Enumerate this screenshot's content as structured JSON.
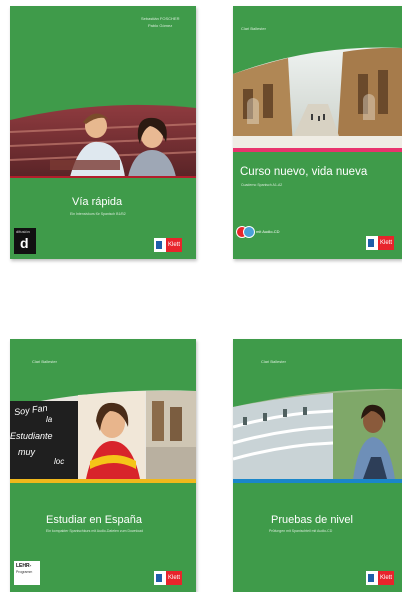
{
  "covers": [
    {
      "title": "Vía rápida",
      "author": "Sebastián FOSCHER",
      "author2": "Pablo Gómez",
      "subtitle": "Ein Intensivkurs für Spanisch B1/B2",
      "publisher_small": "difusión",
      "publisher_logo_glyph": "d",
      "klett_label": "Klett",
      "colors": {
        "bg": "#3f9b4a",
        "stripe": "#b21e2b"
      }
    },
    {
      "title": "Curso nuevo, vida nueva",
      "author": "Clari Ballester",
      "subtitle": "Cuaderno Spanisch A1-A2",
      "cd_label": "mit Audio-CD",
      "klett_label": "Klett",
      "colors": {
        "bg": "#3f9b4a",
        "stripe": "#e8336d"
      }
    },
    {
      "title": "Estudiar en España",
      "author": "Clari Ballester",
      "subtitle": "Ein kompakter Spanischkurs mit Audio-Dateien zum Download",
      "handwriting": [
        "Soy Fan",
        "la",
        "Estudiante",
        "muy",
        "loc"
      ],
      "ledh_label": "LEHR-",
      "ledh_sub": "Programm",
      "klett_label": "Klett",
      "colors": {
        "bg": "#3f9b4a",
        "stripe": "#f0b81c"
      }
    },
    {
      "title": "Pruebas de nivel",
      "author": "Clari Ballester",
      "subtitle": "Prüfungen mit Spanischteil mit Audio-CD",
      "klett_label": "Klett",
      "colors": {
        "bg": "#3f9b4a",
        "stripe": "#1a86c9"
      }
    }
  ]
}
